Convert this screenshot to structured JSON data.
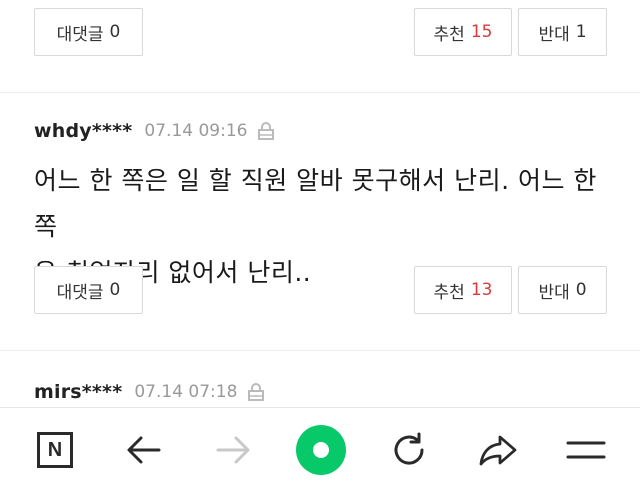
{
  "top_row": {
    "reply_label": "대댓글",
    "reply_count": "0",
    "recommend_label": "추천",
    "recommend_count": "15",
    "oppose_label": "반대",
    "oppose_count": "1"
  },
  "comments": [
    {
      "author": "whdy****",
      "time": "07.14 09:16",
      "text_line1": "어느 한 쪽은 일 할 직원 알바 못구해서 난리. 어느 한 쪽",
      "text_line2": "은 취업자리 없어서 난리..",
      "reply_label": "대댓글",
      "reply_count": "0",
      "recommend_label": "추천",
      "recommend_count": "13",
      "oppose_label": "반대",
      "oppose_count": "0"
    },
    {
      "author": "mirs****",
      "time": "07.14 07:18"
    }
  ],
  "bottom_bar": {
    "home_letter": "N",
    "icons": [
      "naver-home-icon",
      "back-arrow-icon",
      "forward-arrow-icon",
      "green-circle-icon",
      "refresh-icon",
      "share-icon",
      "menu-icon"
    ],
    "accent_color": "#08c96a"
  },
  "colors": {
    "recommend_count": "#d83c3c",
    "time": "#999999"
  }
}
